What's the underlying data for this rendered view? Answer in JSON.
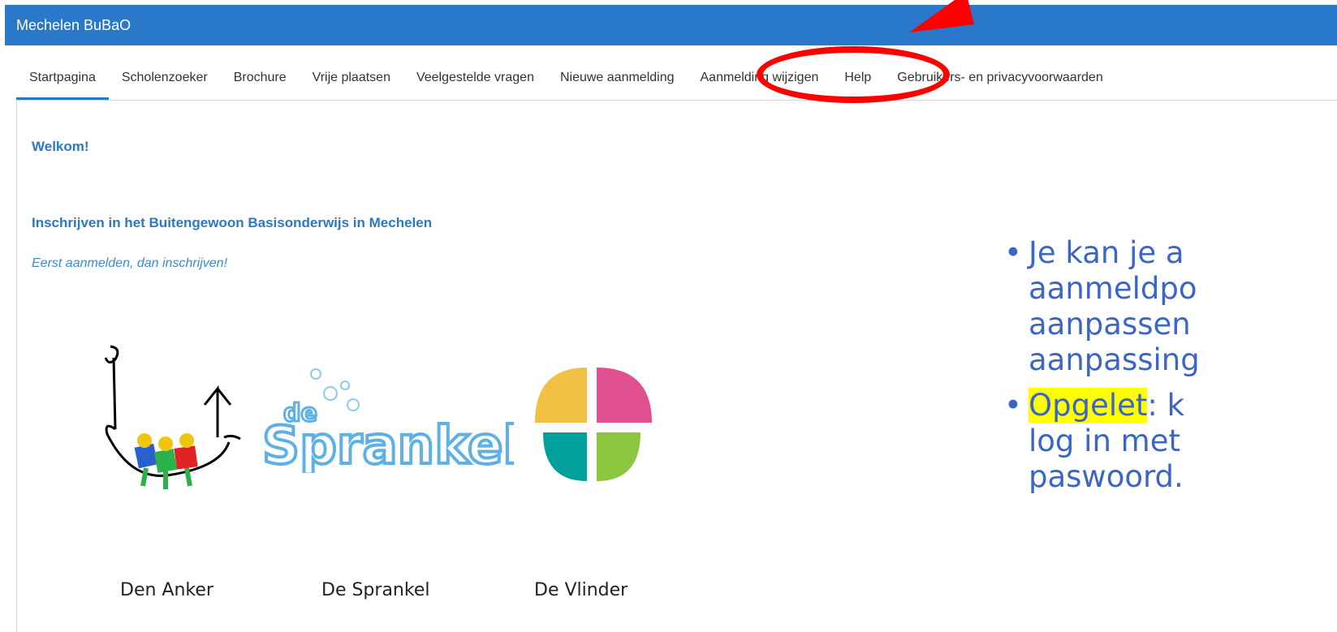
{
  "header": {
    "title": "Mechelen BuBaO"
  },
  "nav": {
    "items": [
      {
        "label": "Startpagina",
        "active": true
      },
      {
        "label": "Scholenzoeker",
        "active": false
      },
      {
        "label": "Brochure",
        "active": false
      },
      {
        "label": "Vrije plaatsen",
        "active": false
      },
      {
        "label": "Veelgestelde vragen",
        "active": false
      },
      {
        "label": "Nieuwe aanmelding",
        "active": false
      },
      {
        "label": "Aanmelding wijzigen",
        "active": false
      },
      {
        "label": "Help",
        "active": false
      },
      {
        "label": "Gebruikers- en privacyvoorwaarden",
        "active": false
      }
    ]
  },
  "main": {
    "welcome": "Welkom!",
    "headline": "Inschrijven in het  Buitengewoon Basisonderwijs in Mechelen",
    "subline": "Eerst aanmelden, dan inschrijven!",
    "schools": [
      {
        "name": "Den Anker"
      },
      {
        "name": "De Sprankel"
      },
      {
        "name": "De Vlinder"
      }
    ],
    "sprankel_logo_text": "de Sprankel"
  },
  "overlay": {
    "bullet1_lines": [
      "Je kan je a",
      "aanmeldpo",
      "aanpassen",
      "aanpassing"
    ],
    "bullet2_highlight": "Opgelet",
    "bullet2_rest": ": k",
    "bullet2_lines": [
      "log in met",
      "paswoord."
    ]
  },
  "colors": {
    "brand": "#2a78c9",
    "overlay_text": "#3b66c9",
    "highlight": "#ffff00",
    "annotation": "#ff0000"
  }
}
